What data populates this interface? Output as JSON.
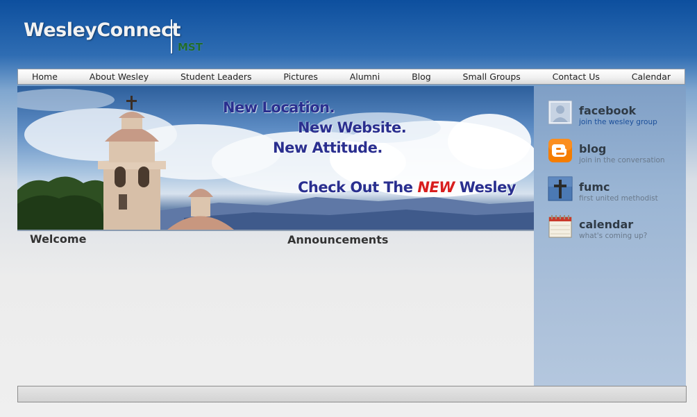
{
  "header": {
    "logo_text": "WesleyConnect",
    "logo_sub": "MST"
  },
  "nav": {
    "items": [
      "Home",
      "About Wesley",
      "Student Leaders",
      "Pictures",
      "Alumni",
      "Blog",
      "Small Groups",
      "Contact Us",
      "Calendar"
    ]
  },
  "banner": {
    "line1": "New Location.",
    "line2": "New Website.",
    "line3": "New Attitude.",
    "line4_prefix": "Check Out The ",
    "line4_highlight": "NEW",
    "line4_suffix": " Wesley"
  },
  "main": {
    "welcome_heading": "Welcome",
    "announcements_heading": "Announcements"
  },
  "sidebar": {
    "items": [
      {
        "title": "facebook",
        "subtitle": "join the wesley group",
        "icon": "facebook-photo-icon"
      },
      {
        "title": "blog",
        "subtitle": "join  in the conversation",
        "icon": "blogger-icon"
      },
      {
        "title": "fumc",
        "subtitle": "first united methodist",
        "icon": "cross-icon"
      },
      {
        "title": "calendar",
        "subtitle": "what's coming up?",
        "icon": "calendar-icon"
      }
    ]
  },
  "colors": {
    "header_top": "#0d4f9e",
    "banner_text": "#2a2f8f",
    "banner_highlight": "#d81e1e",
    "logo_sub": "#1f6b2c",
    "sidebar_bg": "#9ab5d4",
    "link_blue": "#1b4f9a"
  }
}
